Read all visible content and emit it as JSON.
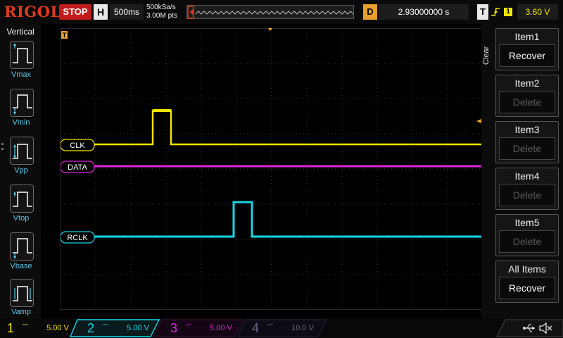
{
  "header": {
    "brand": "RIGOL",
    "run_state": "STOP",
    "timebase_key": "H",
    "timebase": "500ms",
    "sample_rate": "500kSa/s",
    "memory_depth": "3.00M pts",
    "delay_key": "D",
    "delay": "2.93000000 s",
    "trigger_key": "T",
    "trigger_edge_icon": "rising-edge-icon",
    "trigger_source": "1",
    "trigger_level": "3.60 V"
  },
  "measure_panel": {
    "title": "Vertical",
    "items": [
      {
        "label": "Vmax",
        "icon": "vmax-icon"
      },
      {
        "label": "Vmin",
        "icon": "vmin-icon"
      },
      {
        "label": "Vpp",
        "icon": "vpp-icon"
      },
      {
        "label": "Vtop",
        "icon": "vtop-icon"
      },
      {
        "label": "Vbase",
        "icon": "vbase-icon"
      },
      {
        "label": "Vamp",
        "icon": "vamp-icon"
      }
    ]
  },
  "traces": {
    "ch1": {
      "num": "1",
      "label": "CLK",
      "color": "#f2e500"
    },
    "ch3": {
      "num": "3",
      "label": "DATA",
      "color": "#e024e0"
    },
    "ch2": {
      "num": "2",
      "label": "RCLK",
      "color": "#19d6e6"
    },
    "trigger_marker": "T"
  },
  "right_panel": {
    "clear_label": "Clear",
    "items": [
      {
        "title": "Item1",
        "action": "Recover",
        "enabled": true
      },
      {
        "title": "Item2",
        "action": "Delete",
        "enabled": false
      },
      {
        "title": "Item3",
        "action": "Delete",
        "enabled": false
      },
      {
        "title": "Item4",
        "action": "Delete",
        "enabled": false
      },
      {
        "title": "Item5",
        "action": "Delete",
        "enabled": false
      },
      {
        "title": "All Items",
        "action": "Recover",
        "enabled": true
      }
    ]
  },
  "channels": [
    {
      "num": "1",
      "scale": "5.00 V",
      "color": "#f2e500"
    },
    {
      "num": "2",
      "scale": "5.00 V",
      "color": "#19d6e6"
    },
    {
      "num": "3",
      "scale": "5.00 V",
      "color": "#e024e0"
    },
    {
      "num": "4",
      "scale": "10.0 V",
      "color": "#6a6a8a"
    }
  ]
}
